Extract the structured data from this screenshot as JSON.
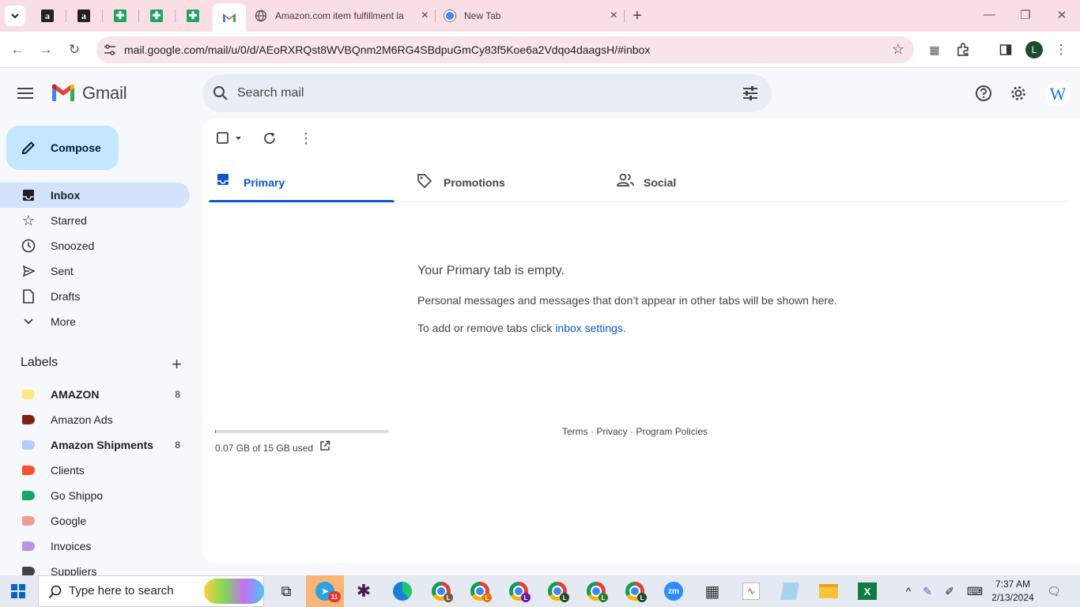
{
  "browser": {
    "tabs": [
      {
        "title": "Amazon.com item fulfillment la",
        "close": "×"
      },
      {
        "title": "New Tab",
        "close": "×"
      }
    ],
    "pinned_icons": [
      "amazon-icon",
      "amazon-icon",
      "sheets-icon",
      "sheets-icon",
      "sheets-icon",
      "gmail-icon"
    ],
    "new_tab": "+",
    "url": "mail.google.com/mail/u/0/d/AEoRXRQst8WVBQnm2M6RG4SBdpuGmCy83f5Koe6a2Vdqo4daagsH/#inbox",
    "profile_initial": "L"
  },
  "gmail": {
    "logo_text": "Gmail",
    "search_placeholder": "Search mail",
    "avatar_initial": "W",
    "compose_label": "Compose",
    "nav": [
      {
        "label": "Inbox",
        "icon": "inbox-icon",
        "active": true
      },
      {
        "label": "Starred",
        "icon": "star-icon"
      },
      {
        "label": "Snoozed",
        "icon": "clock-icon"
      },
      {
        "label": "Sent",
        "icon": "send-icon"
      },
      {
        "label": "Drafts",
        "icon": "draft-icon"
      },
      {
        "label": "More",
        "icon": "chevron-down-icon"
      }
    ],
    "labels_heading": "Labels",
    "labels": [
      {
        "name": "AMAZON",
        "count": "8",
        "color": "#fbe983",
        "bold": true
      },
      {
        "name": "Amazon Ads",
        "count": "",
        "color": "#822111",
        "bold": false
      },
      {
        "name": "Amazon Shipments",
        "count": "8",
        "color": "#b3cefb",
        "bold": true
      },
      {
        "name": "Clients",
        "count": "",
        "color": "#fb4c2f",
        "bold": false
      },
      {
        "name": "Go Shippo",
        "count": "",
        "color": "#16a766",
        "bold": false
      },
      {
        "name": "Google",
        "count": "",
        "color": "#efa093",
        "bold": false
      },
      {
        "name": "Invoices",
        "count": "",
        "color": "#b694e8",
        "bold": false
      },
      {
        "name": "Suppliers",
        "count": "",
        "color": "#444444",
        "bold": false
      }
    ],
    "tabs": [
      {
        "label": "Primary",
        "icon": "inbox-icon",
        "active": true
      },
      {
        "label": "Promotions",
        "icon": "tag-icon"
      },
      {
        "label": "Social",
        "icon": "people-icon"
      }
    ],
    "empty": {
      "heading": "Your Primary tab is empty.",
      "line1": "Personal messages and messages that don’t appear in other tabs will be shown here.",
      "line2_prefix": "To add or remove tabs click ",
      "line2_link": "inbox settings",
      "line2_suffix": "."
    },
    "storage": {
      "text": "0.07 GB of 15 GB used",
      "fraction": 0.005
    },
    "footer": {
      "terms": "Terms",
      "privacy": "Privacy",
      "policies": "Program Policies",
      "sep": " · "
    }
  },
  "taskbar": {
    "search_placeholder": "Type here to search",
    "telegram_badge": "11",
    "time": "7:37 AM",
    "date": "2/13/2024"
  },
  "colors": {
    "accent": "#0b57d0",
    "compose_bg": "#c2e7ff",
    "inbox_active_bg": "#d3e3fd",
    "tabbar_bg": "#f9dfe4"
  }
}
